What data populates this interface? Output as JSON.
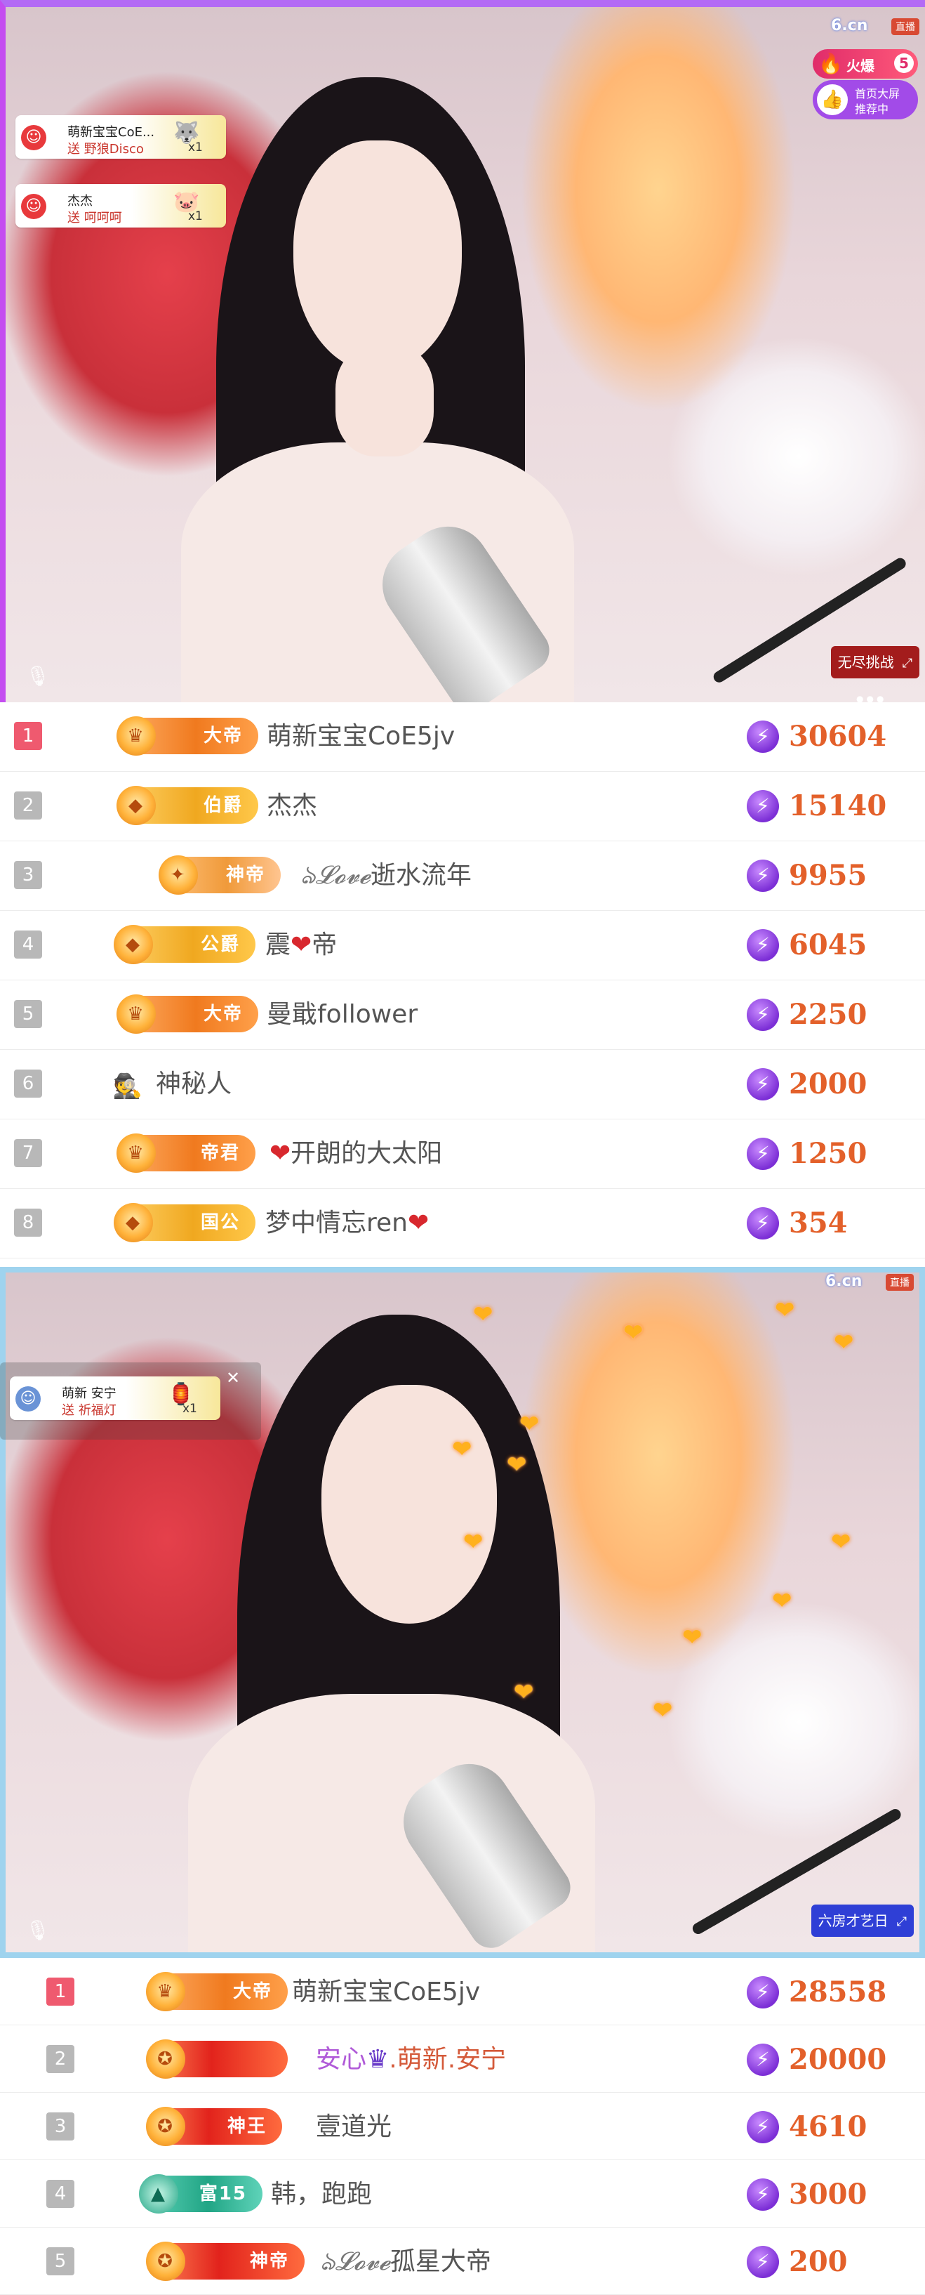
{
  "brand": {
    "logo": "6.cn",
    "live": "直播"
  },
  "hot": {
    "label": "火爆",
    "level": "5"
  },
  "recommend": {
    "line1": "首页大屏",
    "line2": "推荐中"
  },
  "video1": {
    "gifts": [
      {
        "user": "萌新宝宝CoE...",
        "gift": "送 野狼Disco",
        "count": "x1"
      },
      {
        "user": "杰杰",
        "gift": "送 呵呵呵",
        "count": "x1"
      }
    ],
    "badge": "无尽挑战"
  },
  "video2": {
    "gifts": [
      {
        "user": "萌新 安宁",
        "gift": "送 祈福灯",
        "count": "x1"
      }
    ],
    "badge": "六房才艺日"
  },
  "ranking1": [
    {
      "rank": "1",
      "title": "大帝",
      "user": "萌新宝宝CoE5jv",
      "score": "30604"
    },
    {
      "rank": "2",
      "title": "伯爵",
      "user": "杰杰",
      "score": "15140"
    },
    {
      "rank": "3",
      "title": "神帝",
      "user_prefix": "ঌ𝓛𝓸𝓿𝓮",
      "user": "逝水流年",
      "score": "9955"
    },
    {
      "rank": "4",
      "title": "公爵",
      "user_a": "震",
      "user_b": "帝",
      "score": "6045"
    },
    {
      "rank": "5",
      "title": "大帝",
      "user": "曼戢follower",
      "score": "2250"
    },
    {
      "rank": "6",
      "title": "",
      "user": "神秘人",
      "score": "2000"
    },
    {
      "rank": "7",
      "title": "帝君",
      "user": "开朗的大太阳",
      "score": "1250"
    },
    {
      "rank": "8",
      "title": "国公",
      "user": "梦中情忘ren",
      "score": "354"
    }
  ],
  "ranking2": [
    {
      "rank": "1",
      "title": "大帝",
      "user": "萌新宝宝CoE5jv",
      "score": "28558"
    },
    {
      "rank": "2",
      "title": "",
      "user_a": "安心",
      "user_b": ".萌新.安宁",
      "score": "20000"
    },
    {
      "rank": "3",
      "title": "神王",
      "user": "壹道光",
      "score": "4610"
    },
    {
      "rank": "4",
      "title": "富15",
      "user": "韩，跑跑",
      "score": "3000"
    },
    {
      "rank": "5",
      "title": "神帝",
      "user_prefix": "ঌ𝓛𝓸𝓿𝓮",
      "user": "孤星大帝",
      "score": "200"
    }
  ]
}
